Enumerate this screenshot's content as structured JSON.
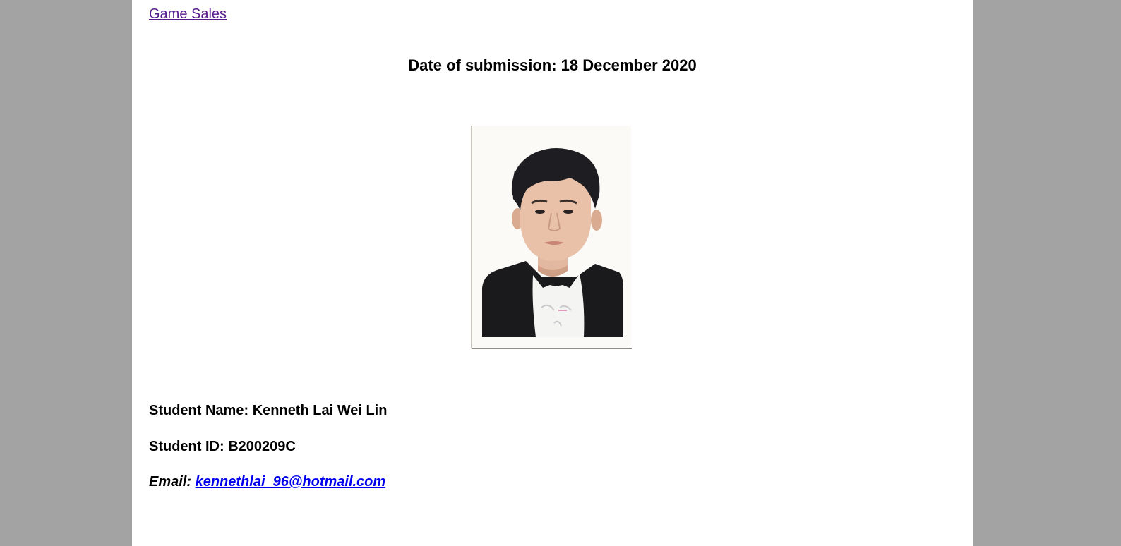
{
  "nav": {
    "home_link": "Game Sales"
  },
  "header": {
    "date_label": "Date of submission:",
    "date_value": "18 December 2020"
  },
  "student": {
    "name_label": "Student Name:",
    "name_value": "Kenneth Lai Wei Lin",
    "id_label": "Student ID:",
    "id_value": "B200209C",
    "email_label": "Email:",
    "email_value": "kennethlai_96@hotmail.com"
  },
  "colors": {
    "background": "#a3a3a3",
    "page": "#ffffff",
    "visited_link": "#551a8b",
    "link": "#0000ee"
  }
}
